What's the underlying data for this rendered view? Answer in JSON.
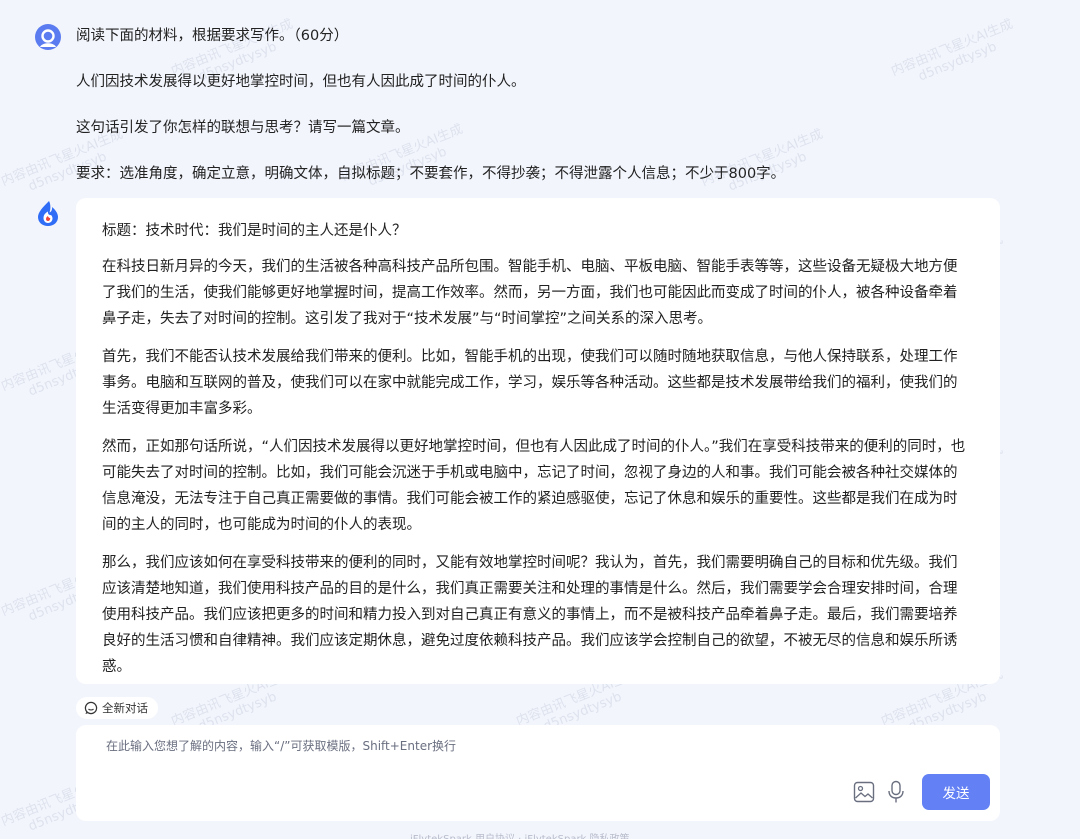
{
  "conversation": {
    "prompt_lines": [
      "阅读下面的材料，根据要求写作。（60分）",
      "人们因技术发展得以更好地掌控时间，但也有人因此成了时间的仆人。",
      "这句话引发了你怎样的联想与思考？请写一篇文章。",
      "要求：选准角度，确定立意，明确文体，自拟标题；不要套作，不得抄袭；不得泄露个人信息；不少于800字。"
    ],
    "answer": {
      "title": "标题：技术时代：我们是时间的主人还是仆人？",
      "paragraphs": [
        "在科技日新月异的今天，我们的生活被各种高科技产品所包围。智能手机、电脑、平板电脑、智能手表等等，这些设备无疑极大地方便了我们的生活，使我们能够更好地掌握时间，提高工作效率。然而，另一方面，我们也可能因此而变成了时间的仆人，被各种设备牵着鼻子走，失去了对时间的控制。这引发了我对于“技术发展”与“时间掌控”之间关系的深入思考。",
        "首先，我们不能否认技术发展给我们带来的便利。比如，智能手机的出现，使我们可以随时随地获取信息，与他人保持联系，处理工作事务。电脑和互联网的普及，使我们可以在家中就能完成工作，学习，娱乐等各种活动。这些都是技术发展带给我们的福利，使我们的生活变得更加丰富多彩。",
        "然而，正如那句话所说，“人们因技术发展得以更好地掌控时间，但也有人因此成了时间的仆人。”我们在享受科技带来的便利的同时，也可能失去了对时间的控制。比如，我们可能会沉迷于手机或电脑中，忘记了时间，忽视了身边的人和事。我们可能会被各种社交媒体的信息淹没，无法专注于自己真正需要做的事情。我们可能会被工作的紧迫感驱使，忘记了休息和娱乐的重要性。这些都是我们在成为时间的主人的同时，也可能成为时间的仆人的表现。",
        "那么，我们应该如何在享受科技带来的便利的同时，又能有效地掌控时间呢？我认为，首先，我们需要明确自己的目标和优先级。我们应该清楚地知道，我们使用科技产品的目的是什么，我们真正需要关注和处理的事情是什么。然后，我们需要学会合理安排时间，合理使用科技产品。我们应该把更多的时间和精力投入到对自己真正有意义的事情上，而不是被科技产品牵着鼻子走。最后，我们需要培养良好的生活习惯和自律精神。我们应该定期休息，避免过度依赖科技产品。我们应该学会控制自己的欲望，不被无尽的信息和娱乐所诱惑。"
      ]
    }
  },
  "new_chat_label": "全新对话",
  "input": {
    "placeholder": "在此输入您想了解的内容，输入“/”可获取模版，Shift+Enter换行",
    "value": ""
  },
  "send_label": "发送",
  "footer": "iFlytekSpark 用户协议 · iFlytekSpark 隐私政策",
  "watermark": [
    "内容由讯飞星火AI生成",
    "d5nsydtysyb"
  ],
  "colors": {
    "background": "#f2f5fc",
    "card": "#ffffff",
    "send_button": "#6381f5",
    "user_avatar": "#5b7cf0"
  },
  "icons": {
    "user_avatar": "user-avatar-icon",
    "bot_avatar": "spark-logo-icon",
    "new_chat": "chat-bubble-icon",
    "image": "image-icon",
    "mic": "microphone-icon"
  }
}
